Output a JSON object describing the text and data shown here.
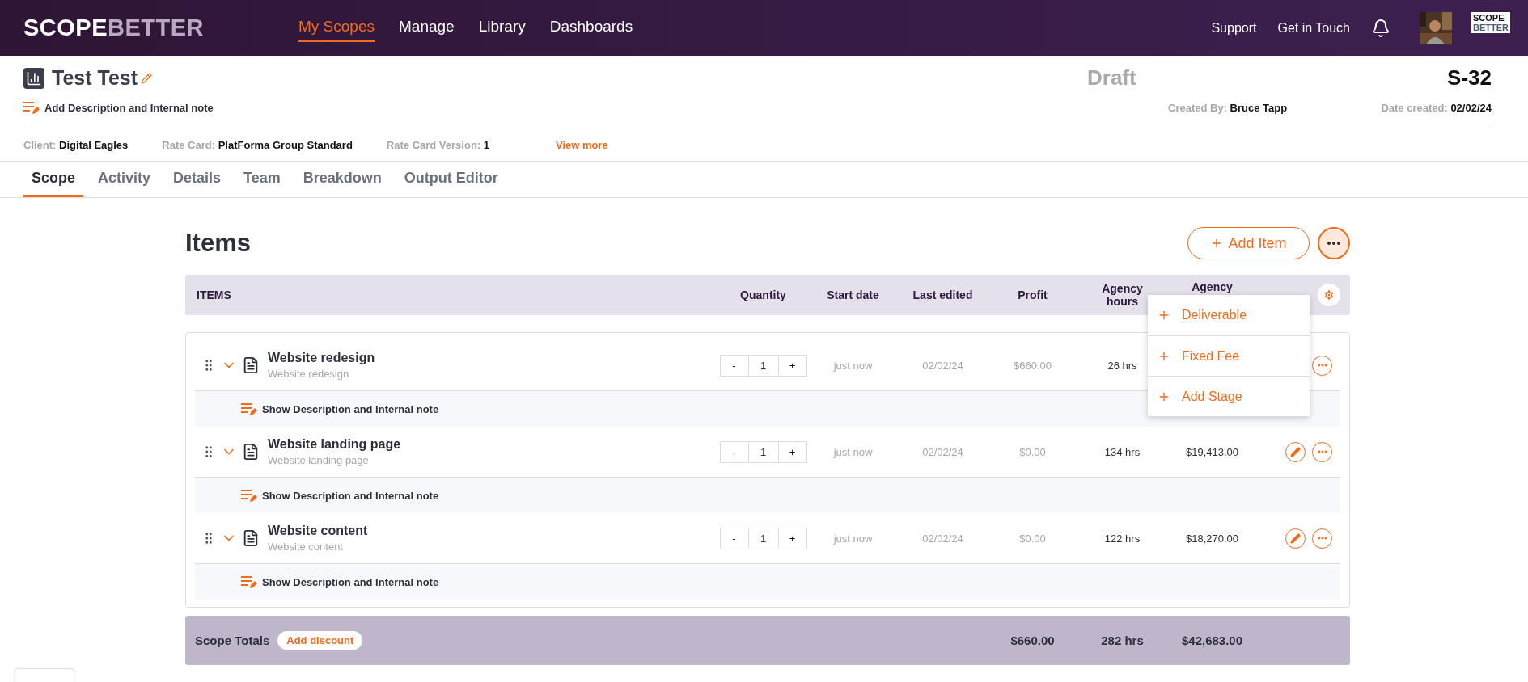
{
  "navbar": {
    "logo": {
      "first": "SCOPE",
      "second": "BETTER"
    },
    "links": [
      {
        "label": "My Scopes",
        "selected": true
      },
      {
        "label": "Manage",
        "selected": false
      },
      {
        "label": "Library",
        "selected": false
      },
      {
        "label": "Dashboards",
        "selected": false
      }
    ],
    "right_links": [
      "Support",
      "Get in Touch"
    ],
    "org_logo": {
      "first": "SCOPE",
      "second": "BETTER"
    }
  },
  "scope": {
    "title": "Test Test",
    "description_link": "Add Description and Internal note",
    "status": "Draft",
    "number": "S-32",
    "created_by": {
      "label": "Created By:",
      "value": "Bruce Tapp"
    },
    "date_created": {
      "label": "Date created:",
      "value": "02/02/24"
    },
    "meta": [
      {
        "label": "Client:",
        "value": "Digital Eagles"
      },
      {
        "label": "Rate Card:",
        "value": "PlatForma Group Standard"
      },
      {
        "label": "Rate Card Version:",
        "value": "1"
      }
    ],
    "view_more": "View more"
  },
  "tabs": [
    {
      "label": "Scope",
      "selected": true
    },
    {
      "label": "Activity",
      "selected": false
    },
    {
      "label": "Details",
      "selected": false
    },
    {
      "label": "Team",
      "selected": false
    },
    {
      "label": "Breakdown",
      "selected": false
    },
    {
      "label": "Output Editor",
      "selected": false
    }
  ],
  "items": {
    "heading": "Items",
    "add_button": "Add Item",
    "more_button": {
      "expanded": true
    },
    "menu": [
      "Deliverable",
      "Fixed Fee",
      "Add Stage"
    ],
    "columns": [
      "ITEMS",
      "Quantity",
      "Start date",
      "Last edited",
      "Profit",
      "Agency hours",
      "Agency"
    ],
    "rows": [
      {
        "name": "Website redesign",
        "subtitle": "Website redesign",
        "quantity": {
          "decrease": "-",
          "value": "1",
          "increase": "+"
        },
        "start": "just now",
        "edited": "02/02/24",
        "profit": "$660.00",
        "hours": "26 hrs",
        "note_link": "Show Description and Internal note"
      },
      {
        "name": "Website landing page",
        "subtitle": "Website landing page",
        "quantity": {
          "decrease": "-",
          "value": "1",
          "increase": "+"
        },
        "start": "just now",
        "edited": "02/02/24",
        "profit": "$0.00",
        "hours": "134 hrs",
        "agency": "$19,413.00",
        "edit_button": true,
        "note_link": "Show Description and Internal note"
      },
      {
        "name": "Website content",
        "subtitle": "Website content",
        "quantity": {
          "decrease": "-",
          "value": "1",
          "increase": "+"
        },
        "start": "just now",
        "edited": "02/02/24",
        "profit": "$0.00",
        "hours": "122 hrs",
        "agency": "$18,270.00",
        "edit_button": true,
        "note_link": "Show Description and Internal note"
      }
    ],
    "totals": {
      "label": "Scope Totals",
      "discount_button": "Add discount",
      "profit": "$660.00",
      "hours": "282 hrs",
      "agency": "$42,683.00"
    }
  }
}
